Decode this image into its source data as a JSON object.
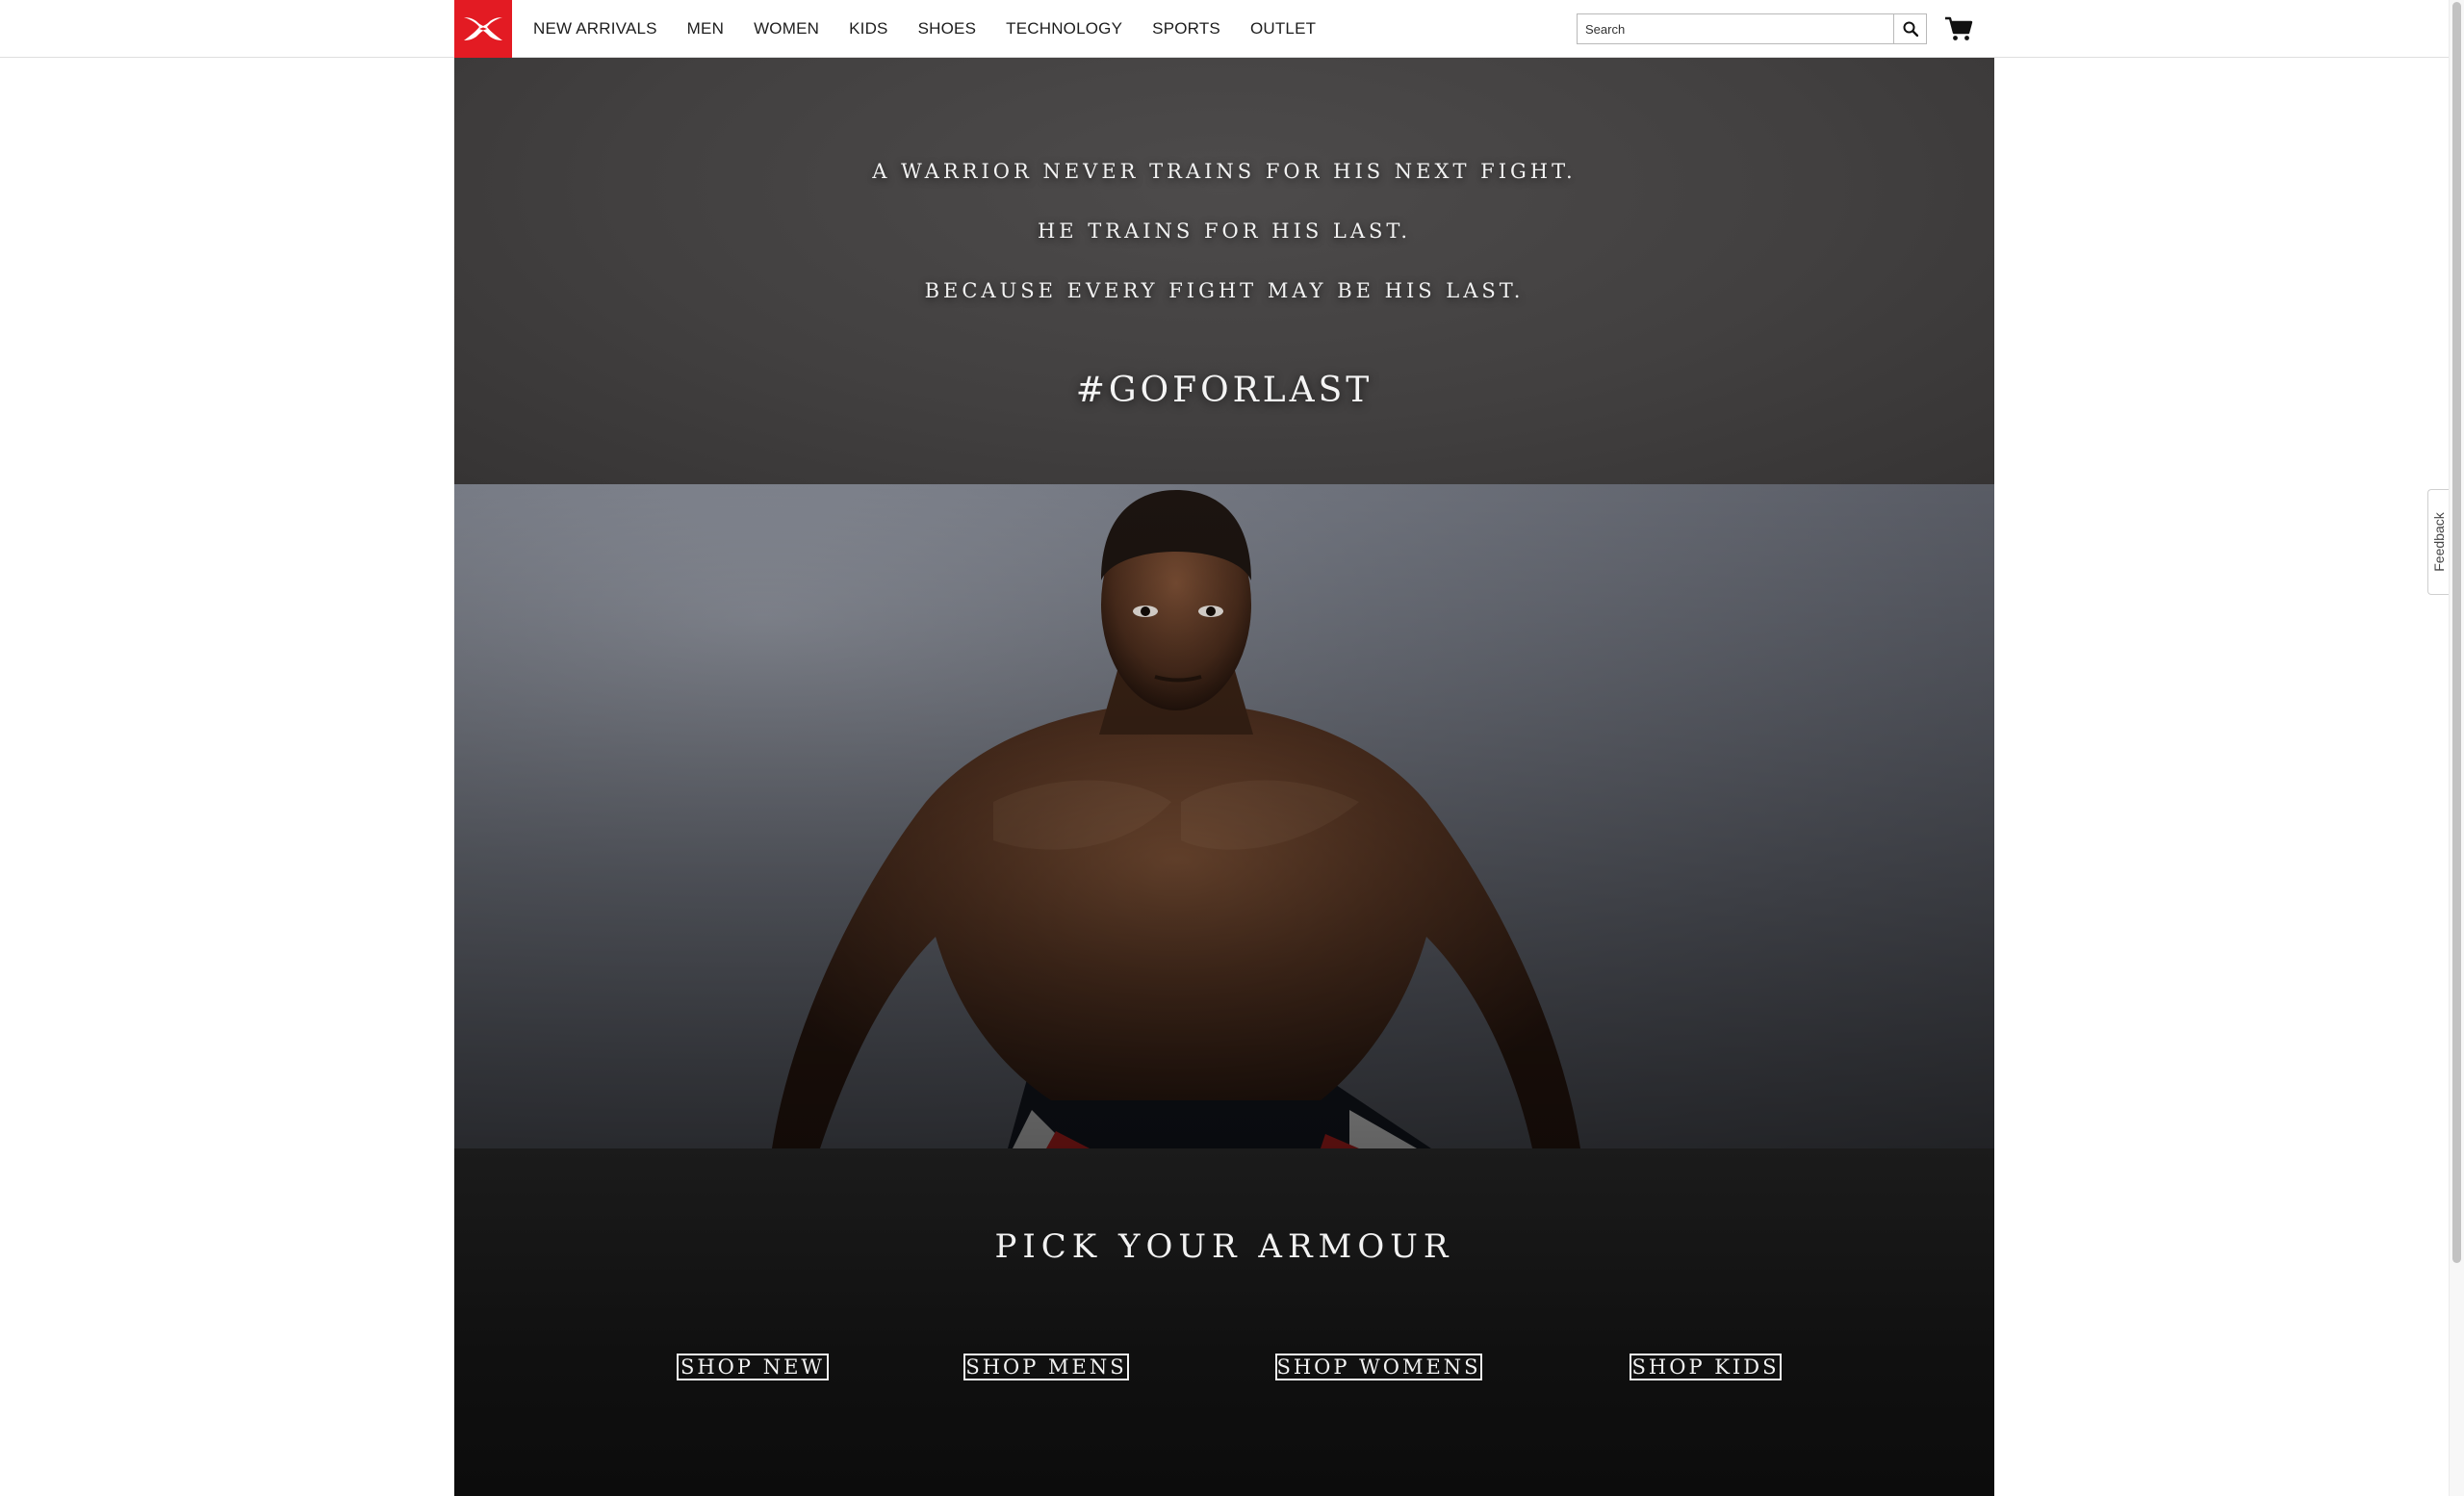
{
  "header": {
    "logo_icon": "under-armour-logo",
    "brand_color": "#e31b23",
    "nav_items": [
      "NEW ARRIVALS",
      "MEN",
      "WOMEN",
      "KIDS",
      "SHOES",
      "TECHNOLOGY",
      "SPORTS",
      "OUTLET"
    ],
    "search_placeholder": "Search",
    "search_icon": "search-icon",
    "cart_icon": "cart-icon"
  },
  "quote": {
    "lines": [
      "A WARRIOR NEVER TRAINS FOR HIS NEXT FIGHT.",
      "HE TRAINS FOR HIS LAST.",
      "BECAUSE EVERY FIGHT MAY BE HIS LAST."
    ],
    "hashtag": "#GOFORLAST"
  },
  "hero": {
    "image": "shirtless-athlete-in-fighting-stance"
  },
  "pick": {
    "title": "PICK YOUR ARMOUR",
    "buttons": [
      "SHOP NEW",
      "SHOP MENS",
      "SHOP WOMENS",
      "SHOP KIDS"
    ]
  },
  "feedback": {
    "label": "Feedback"
  }
}
